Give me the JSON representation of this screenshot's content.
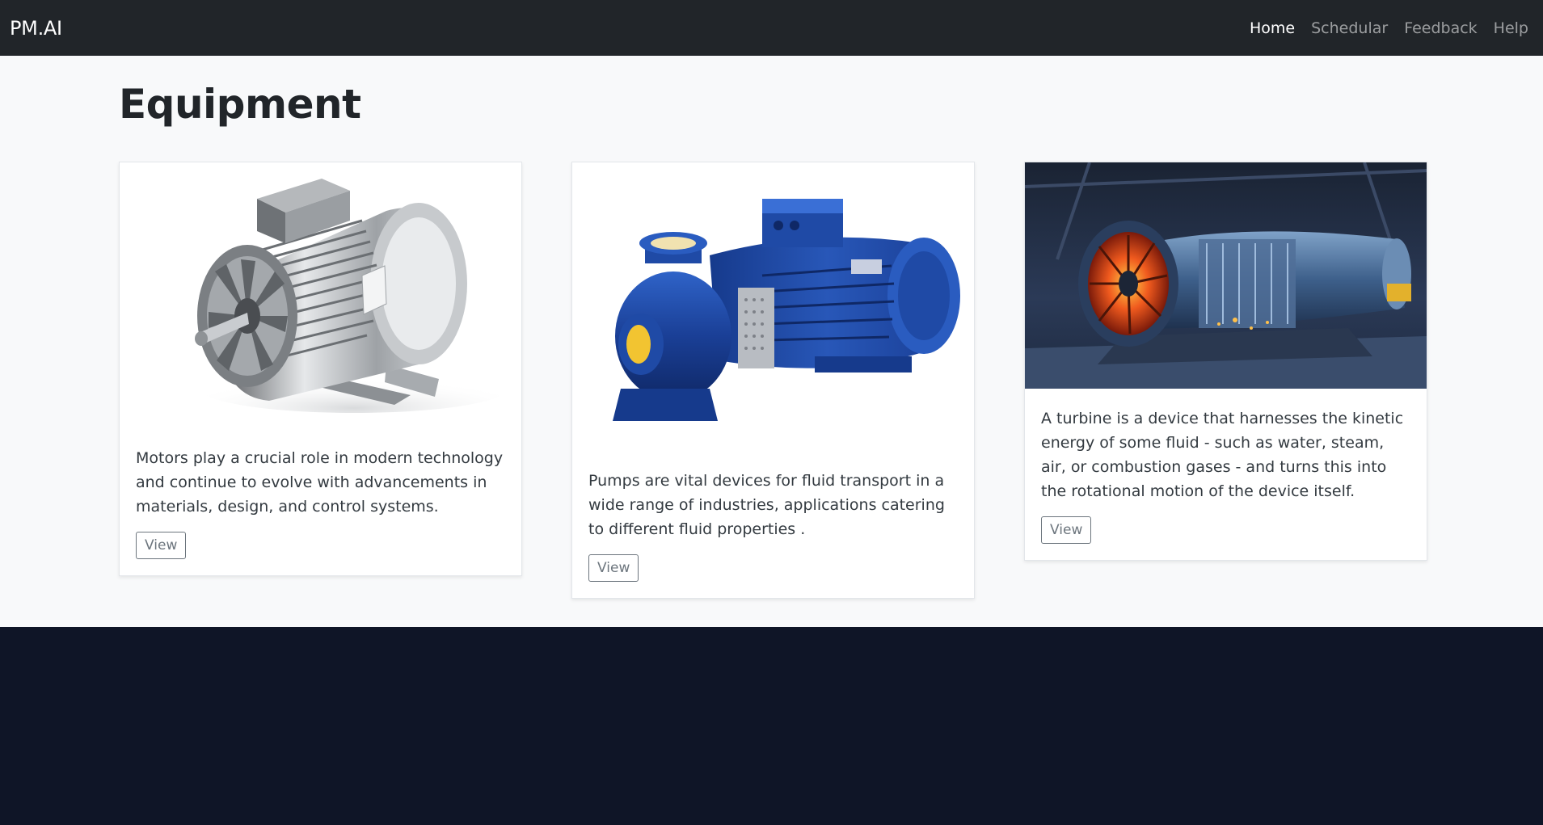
{
  "navbar": {
    "brand": "PM.AI",
    "links": [
      {
        "label": "Home",
        "active": true
      },
      {
        "label": "Schedular",
        "active": false
      },
      {
        "label": "Feedback",
        "active": false
      },
      {
        "label": "Help",
        "active": false
      }
    ]
  },
  "page": {
    "title": "Equipment"
  },
  "cards": [
    {
      "image": "electric-motor-photo",
      "text": "Motors play a crucial role in modern technology and continue to evolve with advancements in materials, design, and control systems.",
      "button_label": "View"
    },
    {
      "image": "blue-centrifugal-pump-photo",
      "text": "Pumps are vital devices for fluid transport in a wide range of industries, applications catering to different fluid properties .",
      "button_label": "View"
    },
    {
      "image": "turbine-engine-photo",
      "text": "A turbine is a device that harnesses the kinetic energy of some fluid - such as water, steam, air, or combustion gases - and turns this into the rotational motion of the device itself.",
      "button_label": "View"
    }
  ],
  "colors": {
    "navbar_bg": "#212529",
    "main_bg": "#f8f9fa",
    "footer_bg": "#0f1527",
    "pump_blue": "#1a3f96",
    "turbine_glow": "#f05a1e"
  }
}
